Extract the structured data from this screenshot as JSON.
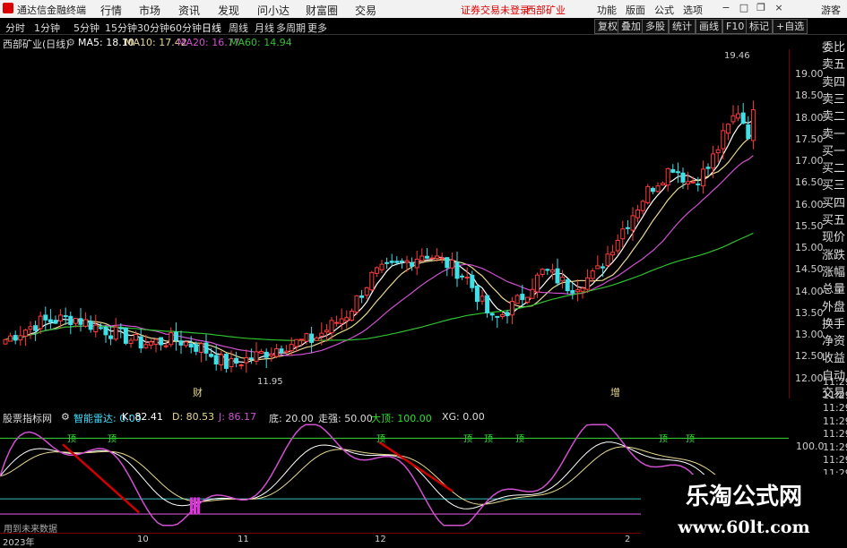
{
  "titlebar": {
    "app_title": "通达信金融终端",
    "menu": [
      "行情",
      "市场",
      "资讯",
      "发现",
      "问小达",
      "财富圈",
      "交易"
    ],
    "login_status": "证券交易未登录",
    "stock_name": "西部矿业",
    "right_menu": [
      "功能",
      "版面",
      "公式",
      "选项"
    ],
    "guest": "游客"
  },
  "toolbar": {
    "periods": [
      "分时",
      "1分钟",
      "5分钟",
      "15分钟",
      "30分钟",
      "60分钟",
      "日线",
      "周线",
      "月线",
      "多周期",
      "更多"
    ],
    "active": "日线",
    "right_buttons": [
      "复权",
      "叠加",
      "多股",
      "统计",
      "画线",
      "F10",
      "标记",
      "+自选"
    ]
  },
  "infobar": {
    "stock": "西部矿业(日线)",
    "ma5": "MA5: 18.10",
    "ma10": "MA10: 17.42",
    "ma20": "MA20: 16.77",
    "ma60": "MA60: 14.94"
  },
  "main_chart": {
    "y_ticks": [
      "19.00",
      "18.50",
      "18.00",
      "17.50",
      "17.00",
      "16.50",
      "16.00",
      "15.50",
      "15.00",
      "14.50",
      "14.00",
      "13.50",
      "13.00",
      "12.50",
      "12.00"
    ],
    "y_top_value": 19.5,
    "y_bottom_value": 11.85,
    "high_label": "19.46",
    "low_label": "11.95",
    "markers": [
      "财",
      "增"
    ]
  },
  "sidebar": {
    "items": [
      "委比",
      "卖五",
      "卖四",
      "卖三",
      "卖二",
      "卖一",
      "买一",
      "买二",
      "买三",
      "买四",
      "买五",
      "现价",
      "涨跌",
      "涨幅",
      "总量",
      "外盘",
      "换手",
      "净资",
      "收益",
      "自动",
      "交易"
    ]
  },
  "time_ticks": [
    "11:29",
    "11:29",
    "11:29",
    "11:29",
    "11:29",
    "11:29",
    "11:29",
    "11:29",
    "11:29",
    "11:29",
    "11:29",
    "11:29"
  ],
  "indicator": {
    "name": "股票指标网",
    "radar": "智能雷达: 0.00",
    "k": "K: 82.41",
    "d": "D: 80.53",
    "j": "J: 86.17",
    "bottom": "底: 20.00",
    "mid": "走强: 50.00",
    "top": "大顶: 100.00",
    "xg": "XG: 0.00",
    "y_tick": "100.0",
    "note": "用到未来数据",
    "top_marks": [
      "顶",
      "顶",
      "顶",
      "顶",
      "顶",
      "顶",
      "顶",
      "顶"
    ]
  },
  "date_axis": [
    "2023年",
    "10",
    "11",
    "12",
    "2"
  ],
  "watermark": {
    "main": "乐淘公式网",
    "url": "www.60lt.com"
  },
  "colors": {
    "up": "#ff3b3b",
    "down": "#3fe0e8",
    "ma5": "#ffffff",
    "ma10": "#e8d890",
    "ma20": "#d050d0",
    "ma60": "#30c030",
    "accent_red": "#d00000"
  }
}
